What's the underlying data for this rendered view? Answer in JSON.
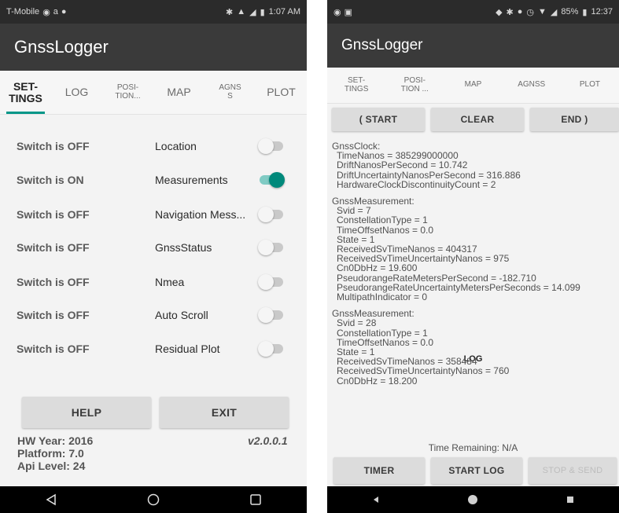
{
  "left": {
    "status": {
      "carrier": "T-Mobile",
      "amazon": "a",
      "time": "1:07 AM"
    },
    "app_title": "GnssLogger",
    "tabs": [
      {
        "label": "SET-\nTINGS"
      },
      {
        "label": "LOG"
      },
      {
        "label": "POSI-\nTION..."
      },
      {
        "label": "MAP"
      },
      {
        "label": "AGNS\nS"
      },
      {
        "label": "PLOT"
      }
    ],
    "settings": [
      {
        "state": "Switch is OFF",
        "name": "Location",
        "on": false
      },
      {
        "state": "Switch is ON",
        "name": "Measurements",
        "on": true
      },
      {
        "state": "Switch is OFF",
        "name": "Navigation Mess...",
        "on": false
      },
      {
        "state": "Switch is OFF",
        "name": "GnssStatus",
        "on": false
      },
      {
        "state": "Switch is OFF",
        "name": "Nmea",
        "on": false
      },
      {
        "state": "Switch is OFF",
        "name": "Auto Scroll",
        "on": false
      },
      {
        "state": "Switch is OFF",
        "name": "Residual Plot",
        "on": false
      }
    ],
    "help_label": "HELP",
    "exit_label": "EXIT",
    "hw_year": "HW Year: 2016",
    "platform": "Platform: 7.0",
    "api_level": "Api Level: 24",
    "version": "v2.0.0.1"
  },
  "right": {
    "status": {
      "battery": "85%",
      "time": "12:37"
    },
    "app_title": "GnssLogger",
    "tabs": [
      {
        "label": "SET-\nTINGS"
      },
      {
        "label": "LOG"
      },
      {
        "label": "POSI-\nTION ..."
      },
      {
        "label": "MAP"
      },
      {
        "label": "AGNSS"
      },
      {
        "label": "PLOT"
      }
    ],
    "start_label": "( START",
    "clear_label": "CLEAR",
    "end_label": "END )",
    "log": {
      "clock_head": "GnssClock:",
      "clock_lines": [
        "TimeNanos = 385299000000",
        "DriftNanosPerSecond = 10.742",
        "DriftUncertaintyNanosPerSecond = 316.886",
        "HardwareClockDiscontinuityCount = 2"
      ],
      "meas1_head": "GnssMeasurement:",
      "meas1_lines": [
        "Svid = 7",
        "ConstellationType = 1",
        "TimeOffsetNanos = 0.0",
        "State = 1",
        "ReceivedSvTimeNanos = 404317",
        "ReceivedSvTimeUncertaintyNanos = 975",
        "Cn0DbHz = 19.600",
        "PseudorangeRateMetersPerSecond = -182.710",
        "PseudorangeRateUncertaintyMetersPerSeconds = 14.099",
        "MultipathIndicator = 0"
      ],
      "meas2_head": "GnssMeasurement:",
      "meas2_lines": [
        "Svid = 28",
        "ConstellationType = 1",
        "TimeOffsetNanos = 0.0",
        "State = 1",
        "ReceivedSvTimeNanos = 358484",
        "ReceivedSvTimeUncertaintyNanos = 760",
        "Cn0DbHz = 18.200"
      ]
    },
    "time_remaining": "Time Remaining: N/A",
    "timer_label": "TIMER",
    "start_log_label": "START LOG",
    "stop_send_label": "STOP & SEND"
  },
  "colors": {
    "accent": "#009688",
    "appbar": "#3a3a3a",
    "statusbar": "#2b2b2b"
  },
  "icons": [
    "back-triangle-icon",
    "home-circle-icon",
    "recents-square-icon"
  ]
}
